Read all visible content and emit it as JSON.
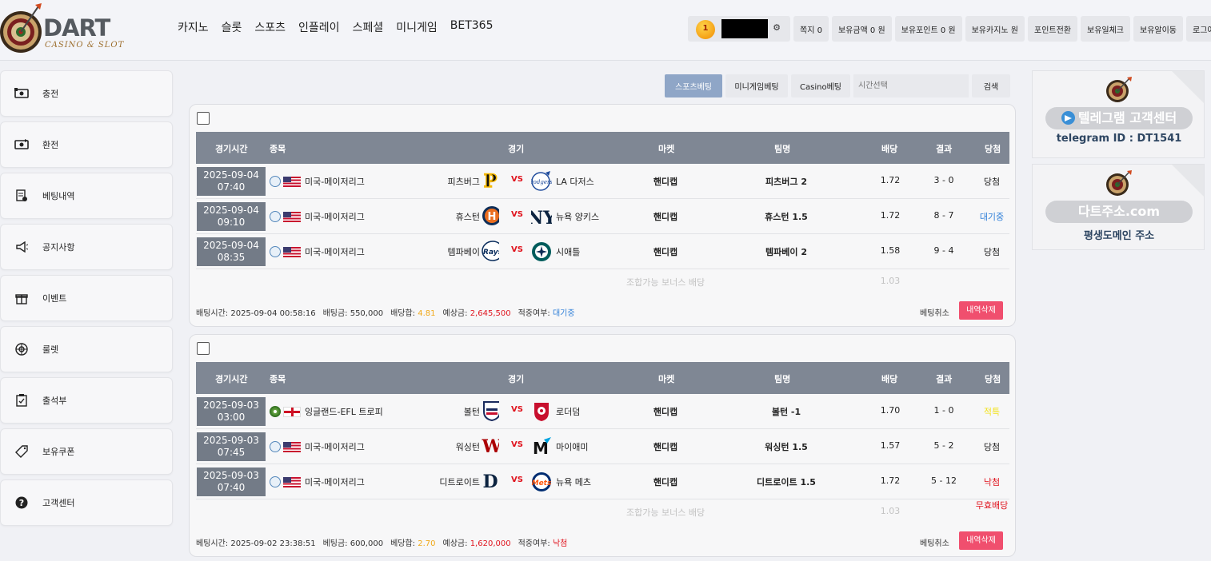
{
  "brand": {
    "name": "DART",
    "sub": "CASINO & SLOT"
  },
  "nav": [
    "카지노",
    "슬롯",
    "스포츠",
    "인플레이",
    "스페셜",
    "미니게임",
    "BET365"
  ],
  "account": {
    "level": "1",
    "items": [
      "쪽지 0",
      "보유금액 0 원",
      "보유포인트 0 원",
      "보유카지노 원",
      "포인트전환",
      "보유일체크",
      "보유알이동",
      "로그아웃"
    ]
  },
  "sidebar": [
    {
      "label": "충전",
      "icon": "cash-in-icon"
    },
    {
      "label": "환전",
      "icon": "cash-exchange-icon"
    },
    {
      "label": "베팅내역",
      "icon": "betting-history-icon"
    },
    {
      "label": "공지사항",
      "icon": "megaphone-icon"
    },
    {
      "label": "이벤트",
      "icon": "gift-icon"
    },
    {
      "label": "룰렛",
      "icon": "roulette-icon"
    },
    {
      "label": "출석부",
      "icon": "attendance-icon"
    },
    {
      "label": "보유쿠폰",
      "icon": "coupon-icon"
    },
    {
      "label": "고객센터",
      "icon": "help-icon"
    }
  ],
  "filter": {
    "tabs": [
      "스포츠베팅",
      "미니게임베팅",
      "Casino베팅"
    ],
    "active": 0,
    "placeholder": "시간선택",
    "search": "검색"
  },
  "columns": [
    "경기시간",
    "종목",
    "경기",
    "마켓",
    "팀명",
    "배당",
    "결과",
    "당첨"
  ],
  "vs": "VS",
  "bets": [
    {
      "rows": [
        {
          "date": "2025-09-04",
          "time": "07:40",
          "sport": "baseball",
          "flag": "us",
          "league": "미국-메이저리그",
          "home": "피츠버그",
          "away": "LA 다저스",
          "market": "핸디캡",
          "pick": "피츠버그 2",
          "odds": "1.72",
          "score": "3 - 0",
          "status": "당첨",
          "status_color": "#222222",
          "home_logo": "pirates-logo-icon",
          "away_logo": "dodgers-logo-icon"
        },
        {
          "date": "2025-09-04",
          "time": "09:10",
          "sport": "baseball",
          "flag": "us",
          "league": "미국-메이저리그",
          "home": "휴스턴",
          "away": "뉴욕 양키스",
          "market": "핸디캡",
          "pick": "휴스턴 1.5",
          "odds": "1.72",
          "score": "8 - 7",
          "status": "대기중",
          "status_color": "#2f7fd8",
          "home_logo": "astros-logo-icon",
          "away_logo": "yankees-logo-icon"
        },
        {
          "date": "2025-09-04",
          "time": "08:35",
          "sport": "baseball",
          "flag": "us",
          "league": "미국-메이저리그",
          "home": "템파베이",
          "away": "시애틀",
          "market": "핸디캡",
          "pick": "템파베이 2",
          "odds": "1.58",
          "score": "9 - 4",
          "status": "당첨",
          "status_color": "#222222",
          "home_logo": "rays-logo-icon",
          "away_logo": "mariners-logo-icon"
        }
      ],
      "bonus_label": "조합가능 보너스 배당",
      "bonus_odds": "1.03",
      "bonus_result": "",
      "footer": {
        "bet_time": "배팅시간: 2025-09-04 00:58:16",
        "amount": "배팅금: 550,000",
        "odds_label": "배당합:",
        "odds": "4.81",
        "expect_label": "예상금:",
        "expect": "2,645,500",
        "result_label": "적중여부:",
        "result": "대기중",
        "result_color": "#2f7fd8"
      },
      "cancel": "베팅취소",
      "delete": "내역삭제"
    },
    {
      "rows": [
        {
          "date": "2025-09-03",
          "time": "03:00",
          "sport": "soccer",
          "flag": "en",
          "league": "잉글랜드-EFL 트로피",
          "home": "볼턴",
          "away": "로더덤",
          "market": "핸디캡",
          "pick": "볼턴 -1",
          "odds": "1.70",
          "score": "1 - 0",
          "status": "적특",
          "status_color": "#f2e21d",
          "home_logo": "bolton-logo-icon",
          "away_logo": "rotherham-logo-icon"
        },
        {
          "date": "2025-09-03",
          "time": "07:45",
          "sport": "baseball",
          "flag": "us",
          "league": "미국-메이저리그",
          "home": "워싱턴",
          "away": "마이애미",
          "market": "핸디캡",
          "pick": "워싱턴 1.5",
          "odds": "1.57",
          "score": "5 - 2",
          "status": "당첨",
          "status_color": "#222222",
          "home_logo": "nationals-logo-icon",
          "away_logo": "marlins-logo-icon"
        },
        {
          "date": "2025-09-03",
          "time": "07:40",
          "sport": "baseball",
          "flag": "us",
          "league": "미국-메이저리그",
          "home": "디트로이트",
          "away": "뉴욕 메츠",
          "market": "핸디캡",
          "pick": "디트로이트 1.5",
          "odds": "1.72",
          "score": "5 - 12",
          "status": "낙첨",
          "status_color": "#e0141e",
          "home_logo": "tigers-logo-icon",
          "away_logo": "mets-logo-icon"
        }
      ],
      "bonus_label": "조합가능 보너스 배당",
      "bonus_odds": "1.03",
      "bonus_result": "무효배당",
      "footer": {
        "bet_time": "베팅시간: 2025-09-02 23:38:51",
        "amount": "베팅금: 600,000",
        "odds_label": "베당합:",
        "odds": "2.70",
        "expect_label": "예상금:",
        "expect": "1,620,000",
        "result_label": "적중여부:",
        "result": "낙첨",
        "result_color": "#e0141e"
      },
      "cancel": "베팅취소",
      "delete": "내역삭제"
    }
  ],
  "right": {
    "telegram": {
      "pill": "텔레그램 고객센터",
      "id": "telegram ID : DT1541"
    },
    "domain": {
      "pill": "다트주소.com",
      "text": "평생도메인 주소"
    }
  },
  "colors": {
    "accent": "#8fa6c7",
    "header_row": "#7f8794",
    "delete": "#f04f6e",
    "gold": "#f0a818",
    "red": "#e0141e"
  }
}
